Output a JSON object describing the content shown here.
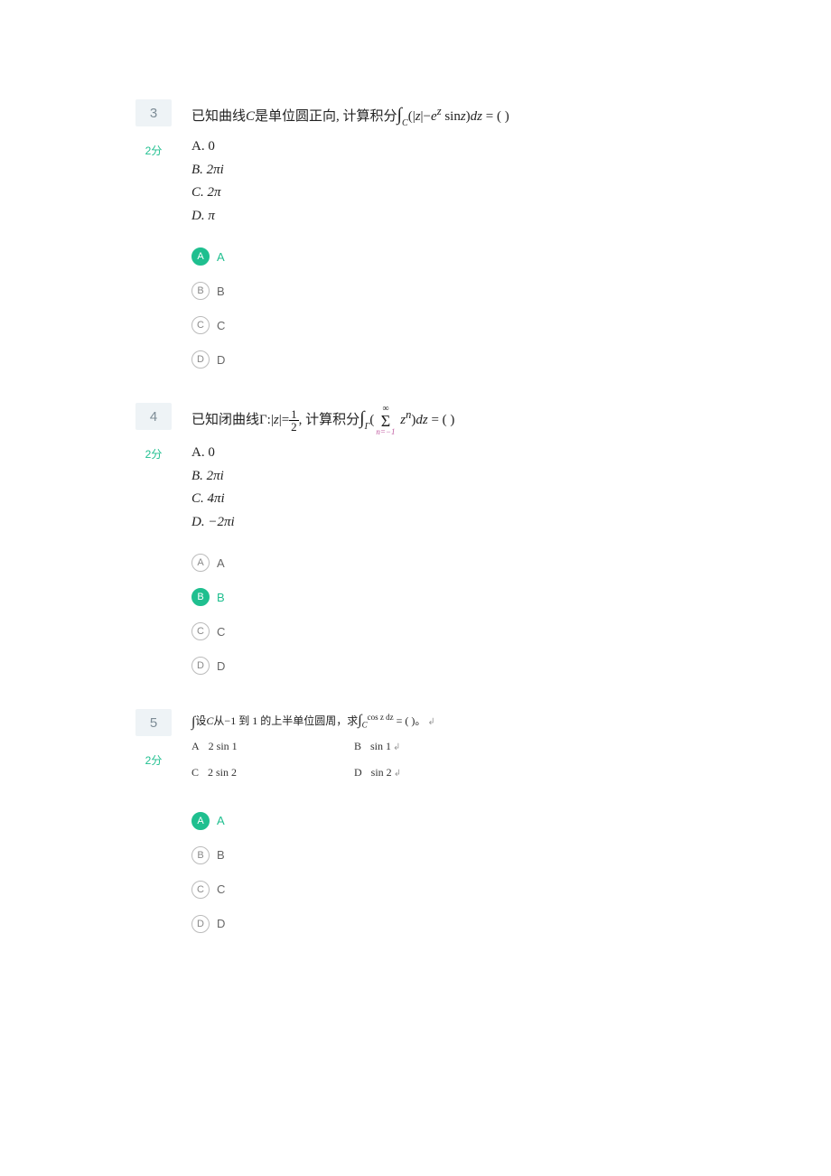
{
  "questions": [
    {
      "number": "3",
      "points": "2分",
      "stem_prefix": "已知曲线",
      "stem_var": "C",
      "stem_mid": "是单位圆正向, 计算积分",
      "stem_int_sub": "C",
      "stem_expr_1": "(|",
      "stem_expr_z1": "z",
      "stem_expr_2": "|−",
      "stem_expr_e": "e",
      "stem_expr_sup": "z",
      "stem_expr_sin": " sin",
      "stem_expr_z2": "z",
      "stem_expr_3": ")",
      "stem_dz": "dz",
      "stem_eq": " = (    )",
      "opts": {
        "A": "A.  0",
        "B": "B.  2πi",
        "C": "C.  2π",
        "D": "D.  π"
      },
      "answers": [
        {
          "letter": "A",
          "label": "A",
          "selected": true
        },
        {
          "letter": "B",
          "label": "B",
          "selected": false
        },
        {
          "letter": "C",
          "label": "C",
          "selected": false
        },
        {
          "letter": "D",
          "label": "D",
          "selected": false
        }
      ]
    },
    {
      "number": "4",
      "points": "2分",
      "stem_prefix": "已知闭曲线Γ:|",
      "stem_z": "z",
      "stem_after_z": "|=",
      "frac_num": "1",
      "frac_den": "2",
      "stem_after_frac": ",  计算积分",
      "stem_int_sub": "Γ",
      "sum_top": "∞",
      "sum_bot": "n=−1",
      "stem_zn_z": "z",
      "stem_zn_n": "n",
      "stem_after_sum": ")",
      "stem_dz": "dz",
      "stem_eq": " = (    )",
      "opts": {
        "A": "A.  0",
        "B": "B.  2πi",
        "C": "C.  4πi",
        "D": "D.  −2πi"
      },
      "answers": [
        {
          "letter": "A",
          "label": "A",
          "selected": false
        },
        {
          "letter": "B",
          "label": "B",
          "selected": true
        },
        {
          "letter": "C",
          "label": "C",
          "selected": false
        },
        {
          "letter": "D",
          "label": "D",
          "selected": false
        }
      ]
    },
    {
      "number": "5",
      "points": "2分",
      "stem_small_1": "设",
      "stem_small_C": "C",
      "stem_small_2": "从−1 到 1 的上半单位圆周，求",
      "stem_int_sub": "C",
      "stem_cosz": "cos z dz",
      "stem_eq": " = (    )。",
      "ret": "↲",
      "inline_opts": {
        "A_lab": "A",
        "A_val": "2 sin 1",
        "B_lab": "B",
        "B_val": "sin 1",
        "C_lab": "C",
        "C_val": "2 sin 2",
        "D_lab": "D",
        "D_val": "sin 2"
      },
      "answers": [
        {
          "letter": "A",
          "label": "A",
          "selected": true
        },
        {
          "letter": "B",
          "label": "B",
          "selected": false
        },
        {
          "letter": "C",
          "label": "C",
          "selected": false
        },
        {
          "letter": "D",
          "label": "D",
          "selected": false
        }
      ]
    }
  ]
}
